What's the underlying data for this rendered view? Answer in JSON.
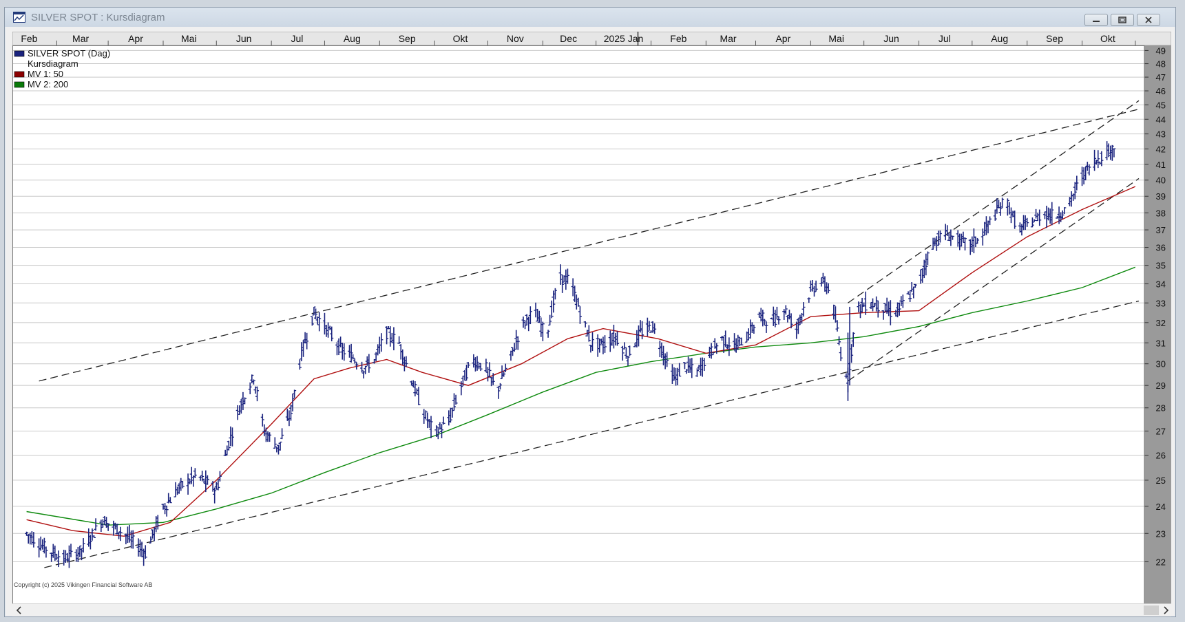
{
  "window": {
    "title": "SILVER SPOT : Kursdiagram",
    "buttons": [
      "minimize-icon",
      "restore-icon",
      "close-icon"
    ]
  },
  "legend": [
    {
      "label": "SILVER SPOT (Dag)",
      "color": "#1a237e"
    },
    {
      "label": "Kursdiagram",
      "color": null
    },
    {
      "label": "MV 1: 50",
      "color": "#8b0000"
    },
    {
      "label": "MV 2: 200",
      "color": "#0a7a0a"
    }
  ],
  "copyright": "Copyright (c) 2025 Vikingen Financial Software AB",
  "chart_data": {
    "type": "candlestick",
    "x_ticks": [
      {
        "label": "Feb",
        "year": 2024
      },
      {
        "label": "Mar",
        "year": 2024
      },
      {
        "label": "Apr",
        "year": 2024
      },
      {
        "label": "Mai",
        "year": 2024
      },
      {
        "label": "Jun",
        "year": 2024
      },
      {
        "label": "Jul",
        "year": 2024
      },
      {
        "label": "Aug",
        "year": 2024
      },
      {
        "label": "Sep",
        "year": 2024
      },
      {
        "label": "Okt",
        "year": 2024
      },
      {
        "label": "Nov",
        "year": 2024
      },
      {
        "label": "Dec",
        "year": 2024
      },
      {
        "label": "2025 Jan",
        "year": 2025
      },
      {
        "label": "Feb",
        "year": 2025
      },
      {
        "label": "Mar",
        "year": 2025
      },
      {
        "label": "Apr",
        "year": 2025
      },
      {
        "label": "Mai",
        "year": 2025
      },
      {
        "label": "Jun",
        "year": 2025
      },
      {
        "label": "Jul",
        "year": 2025
      },
      {
        "label": "Aug",
        "year": 2025
      },
      {
        "label": "Sep",
        "year": 2025
      },
      {
        "label": "Okt",
        "year": 2025
      }
    ],
    "y_ticks": [
      22,
      23,
      24,
      25,
      26,
      27,
      28,
      29,
      30,
      31,
      32,
      33,
      34,
      35,
      36,
      37,
      38,
      39,
      40,
      41,
      42,
      43,
      44,
      45,
      46,
      47,
      48,
      49
    ],
    "y_scale": "log",
    "ylim": [
      21.8,
      49.5
    ],
    "grid": "horizontal",
    "legend_position": "top-left",
    "series": [
      {
        "name": "SILVER SPOT (Dag)",
        "color": "#1a237e",
        "price_path": [
          [
            "2024-01-15",
            23.0
          ],
          [
            "2024-01-25",
            22.5
          ],
          [
            "2024-02-05",
            22.1
          ],
          [
            "2024-02-15",
            22.4
          ],
          [
            "2024-02-27",
            23.5
          ],
          [
            "2024-03-10",
            23.0
          ],
          [
            "2024-03-22",
            22.3
          ],
          [
            "2024-04-01",
            23.9
          ],
          [
            "2024-04-10",
            24.7
          ],
          [
            "2024-04-20",
            25.2
          ],
          [
            "2024-05-01",
            24.6
          ],
          [
            "2024-05-08",
            26.5
          ],
          [
            "2024-05-15",
            28.2
          ],
          [
            "2024-05-22",
            29.4
          ],
          [
            "2024-05-28",
            27.0
          ],
          [
            "2024-06-05",
            26.3
          ],
          [
            "2024-06-12",
            27.8
          ],
          [
            "2024-06-18",
            30.5
          ],
          [
            "2024-06-25",
            32.5
          ],
          [
            "2024-07-03",
            31.6
          ],
          [
            "2024-07-10",
            30.7
          ],
          [
            "2024-07-17",
            30.3
          ],
          [
            "2024-07-23",
            29.8
          ],
          [
            "2024-07-29",
            30.2
          ],
          [
            "2024-08-05",
            31.5
          ],
          [
            "2024-08-12",
            31.0
          ],
          [
            "2024-08-18",
            29.5
          ],
          [
            "2024-08-25",
            27.9
          ],
          [
            "2024-09-01",
            26.9
          ],
          [
            "2024-09-09",
            27.4
          ],
          [
            "2024-09-15",
            28.8
          ],
          [
            "2024-09-22",
            30.2
          ],
          [
            "2024-09-30",
            29.8
          ],
          [
            "2024-10-06",
            28.7
          ],
          [
            "2024-10-13",
            30.1
          ],
          [
            "2024-10-20",
            31.8
          ],
          [
            "2024-10-27",
            32.6
          ],
          [
            "2024-11-03",
            31.3
          ],
          [
            "2024-11-10",
            34.3
          ],
          [
            "2024-11-16",
            34.2
          ],
          [
            "2024-11-22",
            32.6
          ],
          [
            "2024-11-28",
            31.0
          ],
          [
            "2024-12-05",
            30.9
          ],
          [
            "2024-12-12",
            31.3
          ],
          [
            "2024-12-19",
            30.4
          ],
          [
            "2024-12-26",
            31.5
          ],
          [
            "2025-01-02",
            31.8
          ],
          [
            "2025-01-08",
            30.5
          ],
          [
            "2025-01-14",
            29.3
          ],
          [
            "2025-01-20",
            29.9
          ],
          [
            "2025-01-27",
            29.6
          ],
          [
            "2025-02-03",
            30.5
          ],
          [
            "2025-02-10",
            31.2
          ],
          [
            "2025-02-17",
            30.8
          ],
          [
            "2025-02-24",
            31.3
          ],
          [
            "2025-03-03",
            32.3
          ],
          [
            "2025-03-10",
            32.0
          ],
          [
            "2025-03-17",
            32.7
          ],
          [
            "2025-03-24",
            31.7
          ],
          [
            "2025-03-30",
            33.3
          ],
          [
            "2025-04-06",
            34.2
          ],
          [
            "2025-04-12",
            33.7
          ],
          [
            "2025-04-18",
            30.5
          ],
          [
            "2025-04-22",
            29.3
          ],
          [
            "2025-04-27",
            32.7
          ],
          [
            "2025-05-04",
            33.0
          ],
          [
            "2025-05-11",
            32.8
          ],
          [
            "2025-05-18",
            32.4
          ],
          [
            "2025-05-25",
            33.2
          ],
          [
            "2025-06-01",
            34.0
          ],
          [
            "2025-06-08",
            36.1
          ],
          [
            "2025-06-15",
            36.8
          ],
          [
            "2025-06-22",
            36.5
          ],
          [
            "2025-06-29",
            36.1
          ],
          [
            "2025-07-06",
            36.6
          ],
          [
            "2025-07-13",
            37.8
          ],
          [
            "2025-07-20",
            38.8
          ],
          [
            "2025-07-27",
            37.0
          ],
          [
            "2025-08-03",
            37.4
          ],
          [
            "2025-08-10",
            38.0
          ],
          [
            "2025-08-17",
            37.8
          ],
          [
            "2025-08-24",
            38.3
          ],
          [
            "2025-08-31",
            40.1
          ],
          [
            "2025-09-07",
            41.1
          ],
          [
            "2025-09-14",
            41.7
          ],
          [
            "2025-09-19",
            42.1
          ]
        ]
      },
      {
        "name": "MV 1: 50",
        "color": "#b01010",
        "points": [
          [
            "2024-01-15",
            23.5
          ],
          [
            "2024-02-10",
            23.1
          ],
          [
            "2024-03-10",
            22.9
          ],
          [
            "2024-04-05",
            23.4
          ],
          [
            "2024-05-01",
            25.0
          ],
          [
            "2024-06-01",
            27.3
          ],
          [
            "2024-06-25",
            29.3
          ],
          [
            "2024-07-15",
            29.8
          ],
          [
            "2024-08-05",
            30.2
          ],
          [
            "2024-08-25",
            29.6
          ],
          [
            "2024-09-20",
            29.0
          ],
          [
            "2024-10-20",
            30.0
          ],
          [
            "2024-11-15",
            31.2
          ],
          [
            "2024-12-05",
            31.7
          ],
          [
            "2025-01-05",
            31.2
          ],
          [
            "2025-02-01",
            30.5
          ],
          [
            "2025-03-01",
            30.9
          ],
          [
            "2025-04-01",
            32.3
          ],
          [
            "2025-05-01",
            32.5
          ],
          [
            "2025-06-01",
            32.6
          ],
          [
            "2025-07-01",
            34.6
          ],
          [
            "2025-08-01",
            36.6
          ],
          [
            "2025-09-01",
            38.2
          ],
          [
            "2025-10-01",
            39.6
          ]
        ]
      },
      {
        "name": "MV 2: 200",
        "color": "#0e8a0e",
        "points": [
          [
            "2024-01-15",
            23.8
          ],
          [
            "2024-03-01",
            23.3
          ],
          [
            "2024-04-01",
            23.4
          ],
          [
            "2024-05-01",
            23.9
          ],
          [
            "2024-06-01",
            24.5
          ],
          [
            "2024-07-01",
            25.3
          ],
          [
            "2024-08-01",
            26.1
          ],
          [
            "2024-09-01",
            26.8
          ],
          [
            "2024-10-01",
            27.7
          ],
          [
            "2024-11-01",
            28.7
          ],
          [
            "2024-12-01",
            29.6
          ],
          [
            "2025-01-01",
            30.1
          ],
          [
            "2025-02-01",
            30.5
          ],
          [
            "2025-03-01",
            30.8
          ],
          [
            "2025-04-01",
            31.0
          ],
          [
            "2025-05-01",
            31.3
          ],
          [
            "2025-06-01",
            31.8
          ],
          [
            "2025-07-01",
            32.5
          ],
          [
            "2025-08-01",
            33.1
          ],
          [
            "2025-09-01",
            33.8
          ],
          [
            "2025-10-01",
            34.9
          ]
        ]
      }
    ],
    "trendlines": [
      {
        "from": [
          "2024-01-22",
          29.2
        ],
        "to": [
          "2025-10-03",
          44.7
        ],
        "style": "dashed"
      },
      {
        "from": [
          "2024-01-25",
          21.8
        ],
        "to": [
          "2025-10-03",
          33.1
        ],
        "style": "dashed"
      },
      {
        "from": [
          "2025-04-22",
          33.0
        ],
        "to": [
          "2025-10-03",
          45.3
        ],
        "style": "dashed"
      },
      {
        "from": [
          "2025-04-22",
          29.2
        ],
        "to": [
          "2025-10-03",
          40.1
        ],
        "style": "dashed"
      }
    ]
  }
}
